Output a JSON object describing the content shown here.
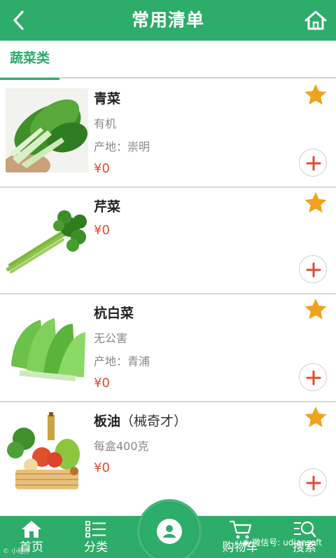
{
  "header": {
    "title": "常用清单",
    "back_icon": "chevron-left-icon",
    "home_icon": "home-icon"
  },
  "tabs": [
    {
      "label": "蔬菜类",
      "active": true
    }
  ],
  "items": [
    {
      "name": "青菜",
      "name_suffix": "",
      "tag": "有机",
      "origin": "产地：崇明",
      "price": "¥0",
      "favorited": true
    },
    {
      "name": "芹菜",
      "name_suffix": "",
      "tag": "",
      "origin": "",
      "price": "¥0",
      "favorited": true
    },
    {
      "name": "杭白菜",
      "name_suffix": "",
      "tag": "无公害",
      "origin": "产地：青浦",
      "price": "¥0",
      "favorited": true
    },
    {
      "name": "板油",
      "name_suffix": "（械奇才）",
      "tag": "每盒400克",
      "origin": "",
      "price": "¥0",
      "favorited": true
    }
  ],
  "bottom_nav": [
    {
      "label": "首页",
      "icon": "home-icon"
    },
    {
      "label": "分类",
      "icon": "list-icon"
    },
    {
      "label": "",
      "icon": "user-icon"
    },
    {
      "label": "购物车",
      "icon": "cart-icon"
    },
    {
      "label": "搜索",
      "icon": "search-icon"
    }
  ],
  "watermark": {
    "left": "© 小程序",
    "right": "微信号: udiansoft"
  },
  "colors": {
    "primary": "#2eac6a",
    "price": "#e44a33",
    "star": "#f0a21d",
    "plus": "#e44a33"
  }
}
